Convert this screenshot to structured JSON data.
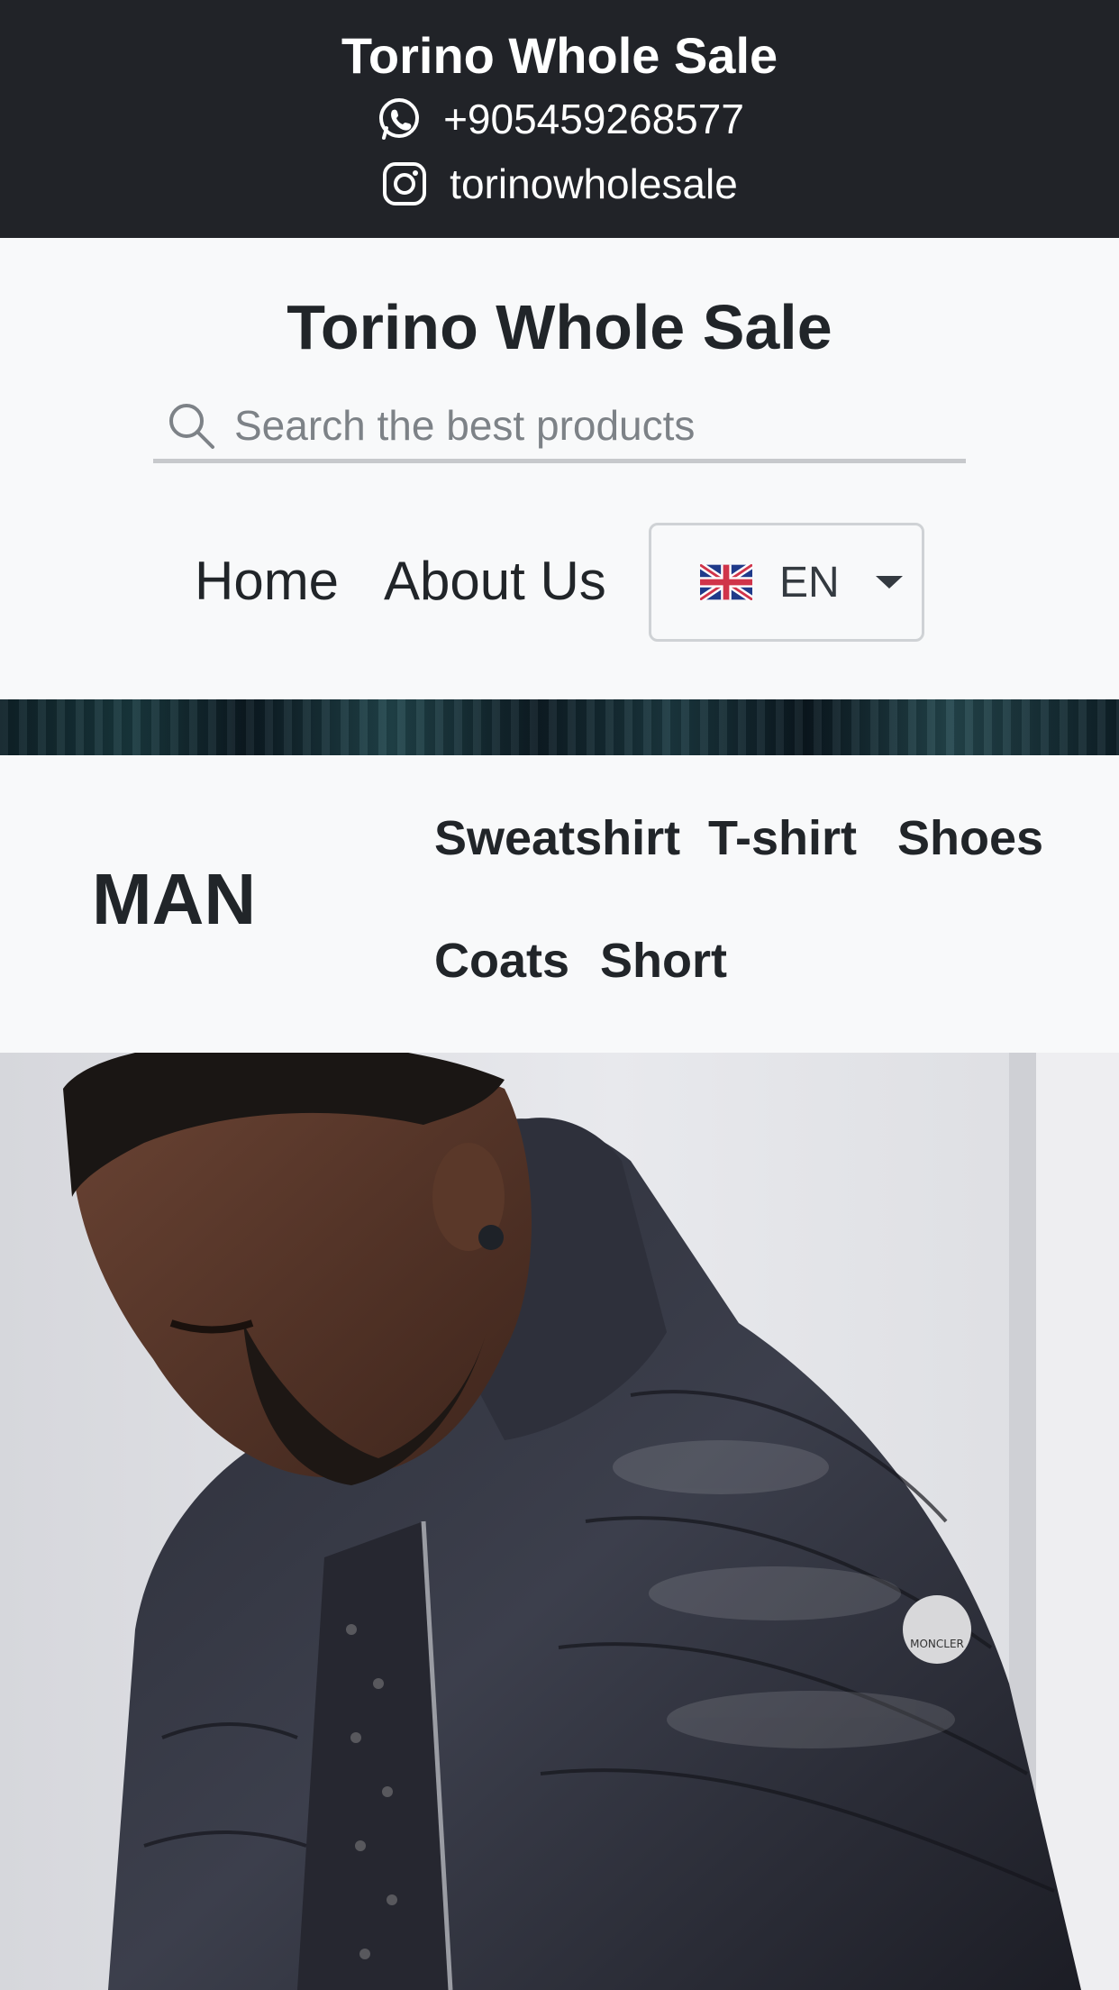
{
  "topbar": {
    "brand": "Torino Whole Sale",
    "phone": "+905459268577",
    "instagram": "torinowholesale",
    "icons": [
      "whatsapp-icon",
      "instagram-icon"
    ]
  },
  "header": {
    "title": "Torino Whole Sale",
    "search_placeholder": "Search the best products",
    "nav": {
      "home": "Home",
      "about": "About Us"
    },
    "language": {
      "code": "EN",
      "flag": "uk-flag-icon"
    }
  },
  "category": {
    "title": "MAN",
    "items": [
      "Sweatshirt",
      "T-shirt",
      "Shoes",
      "Coats",
      "Short"
    ]
  },
  "hero": {
    "badge_text": "MONCLER"
  },
  "colors": {
    "topbar_bg": "#212328",
    "page_bg": "#f8f9fa",
    "text": "#212529"
  }
}
